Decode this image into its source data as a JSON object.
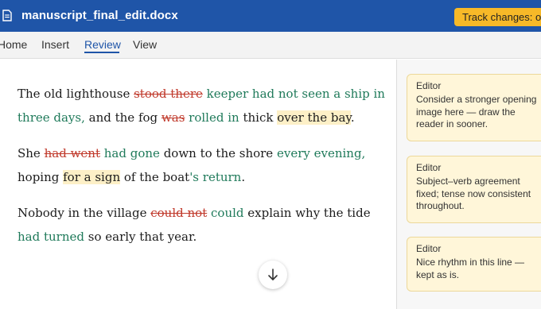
{
  "app": {
    "document_title": "manuscript_final_edit.docx",
    "track_changes_label": "Track changes: on"
  },
  "menu": {
    "tabs": [
      {
        "label": "Home"
      },
      {
        "label": "Insert"
      },
      {
        "label": "Review",
        "active": true
      },
      {
        "label": "View"
      }
    ]
  },
  "document": {
    "p1": {
      "s1": "The old lighthouse ",
      "del1": "stood there",
      "s2": " ",
      "ins1": "keeper had not seen a ship in three days,",
      "s3": " and the fog ",
      "del2": "was",
      "s4": " ",
      "ins2": "rolled in",
      "s5": " thick ",
      "hl1": "over the bay",
      "s6": "."
    },
    "p2": {
      "s1": "She ",
      "del1": "had went",
      "s2": " ",
      "ins1": "had gone",
      "s3": " down to the shore ",
      "ins2": "every evening,",
      "s4": " hoping ",
      "hl1": "for a sign",
      "s5": " of the boat",
      "ins3": "'s return",
      "s6": "."
    },
    "p3": {
      "s1": "Nobody in the village ",
      "del1": "could not",
      "s2": " ",
      "ins1": "could",
      "s3": " explain why the tide ",
      "ins2": "had turned",
      "s4": " so early that year."
    }
  },
  "comments": [
    {
      "author": "Editor",
      "text": "Consider a stronger opening image here — draw the reader in sooner."
    },
    {
      "author": "Editor",
      "text": "Subject–verb agreement fixed; tense now consistent throughout."
    },
    {
      "author": "Editor",
      "text": "Nice rhythm in this line — kept as is."
    }
  ],
  "icons": {
    "doc": "document-icon",
    "scroll": "arrow-down-icon"
  },
  "colors": {
    "titlebar": "#1f55a8",
    "badge": "#f7b928",
    "deleted": "#c0392b",
    "inserted": "#1f7a5a",
    "highlight": "#fdf0c7",
    "comment_card": "#fff6d9"
  }
}
